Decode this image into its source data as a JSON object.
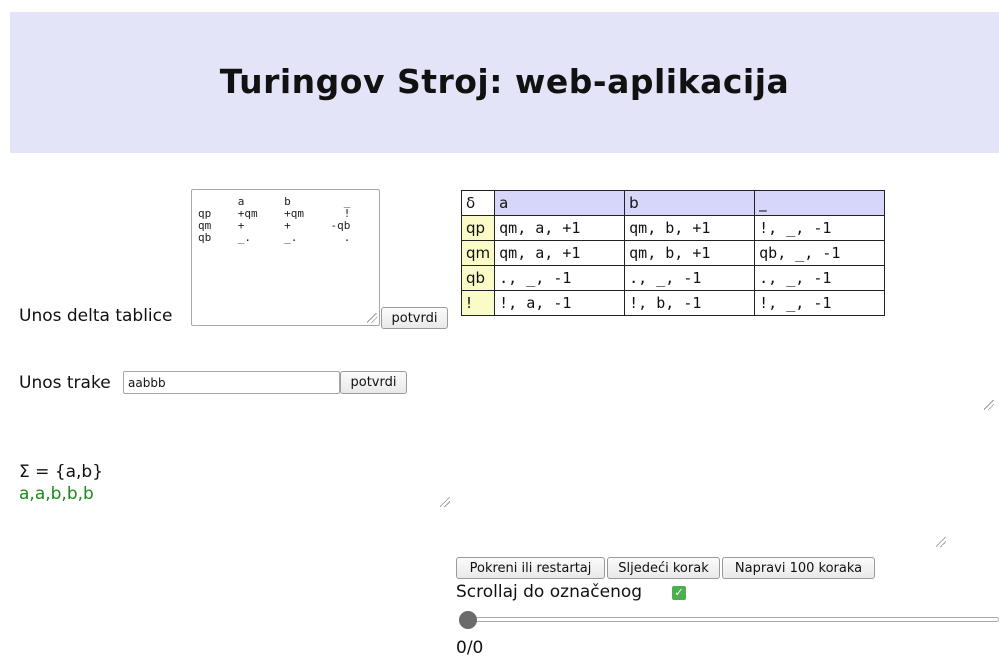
{
  "header": {
    "title": "Turingov Stroj: web-aplikacija"
  },
  "delta_input": {
    "label": "Unos delta tablice",
    "textarea_text": "      a      b        _\nqp    +qm    +qm      !\nqm    +      +      -qb\nqb    _.     _.       .",
    "submit_label": "potvrdi"
  },
  "tape_input": {
    "label": "Unos trake",
    "value": "aabbb",
    "submit_label": "potvrdi"
  },
  "delta_table": {
    "corner": "δ",
    "headers": [
      "a",
      "b",
      "_"
    ],
    "rows": [
      {
        "state": "qp",
        "cells": [
          "qm, a, +1",
          "qm, b, +1",
          "!, _, -1"
        ]
      },
      {
        "state": "qm",
        "cells": [
          "qm, a, +1",
          "qm, b, +1",
          "qb, _, -1"
        ]
      },
      {
        "state": "qb",
        "cells": "., _, -1|., _, -1|., _, -1"
      },
      {
        "state": "!",
        "cells": [
          "!, a, -1",
          "!, b, -1",
          "!, _, -1"
        ]
      }
    ]
  },
  "alphabet": {
    "text": "Σ = {a,b}"
  },
  "tape_display": {
    "text": "a,a,b,b,b"
  },
  "controls": {
    "run_label": "Pokreni ili restartaj",
    "step_label": "Sljedeći korak",
    "hundred_label": "Napravi 100 koraka",
    "scroll_label": "Scrollaj do označenog",
    "scroll_checked": true,
    "step_counter": "0/0",
    "slider_value": 0
  },
  "colors": {
    "header_bg": "#e4e4f8",
    "table_header_bg": "#d6d6fb",
    "state_cell_bg": "#fbfbc8",
    "tape_text": "#1a8a1a",
    "checkbox": "#4caf50"
  }
}
